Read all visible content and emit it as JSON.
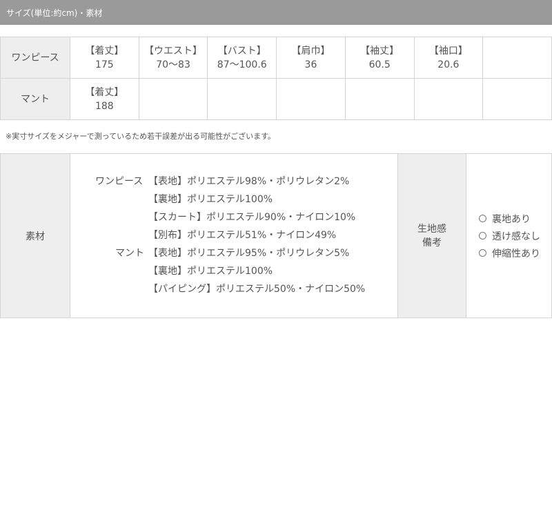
{
  "header": {
    "title": "サイズ(単位:約cm)・素材"
  },
  "size_table": {
    "rows": [
      {
        "name": "ワンピース",
        "cells": [
          {
            "label": "【着丈】",
            "value": "175"
          },
          {
            "label": "【ウエスト】",
            "value": "70〜83"
          },
          {
            "label": "【バスト】",
            "value": "87〜100.6"
          },
          {
            "label": "【肩巾】",
            "value": "36"
          },
          {
            "label": "【袖丈】",
            "value": "60.5"
          },
          {
            "label": "【袖口】",
            "value": "20.6"
          }
        ]
      },
      {
        "name": "マント",
        "cells": [
          {
            "label": "【着丈】",
            "value": "188"
          }
        ]
      }
    ]
  },
  "note": "※実寸サイズをメジャーで測っているため若干誤差が出る可能性がございます。",
  "material": {
    "label": "素材",
    "lines": [
      {
        "item": "ワンピース",
        "text": "【表地】ポリエステル98%・ポリウレタン2%"
      },
      {
        "item": "",
        "text": "【裏地】ポリエステル100%"
      },
      {
        "item": "",
        "text": "【スカート】ポリエステル90%・ナイロン10%"
      },
      {
        "item": "",
        "text": "【別布】ポリエステル51%・ナイロン49%"
      },
      {
        "item": "マント",
        "text": "【表地】ポリエステル95%・ポリウレタン5%"
      },
      {
        "item": "",
        "text": "【裏地】ポリエステル100%"
      },
      {
        "item": "",
        "text": "【パイピング】ポリエステル50%・ナイロン50%"
      }
    ],
    "feel_label_1": "生地感",
    "feel_label_2": "備考",
    "feel_options": [
      {
        "label": "裏地あり",
        "checked": false
      },
      {
        "label": "透け感なし",
        "checked": false
      },
      {
        "label": "伸縮性あり",
        "checked": false
      }
    ]
  }
}
